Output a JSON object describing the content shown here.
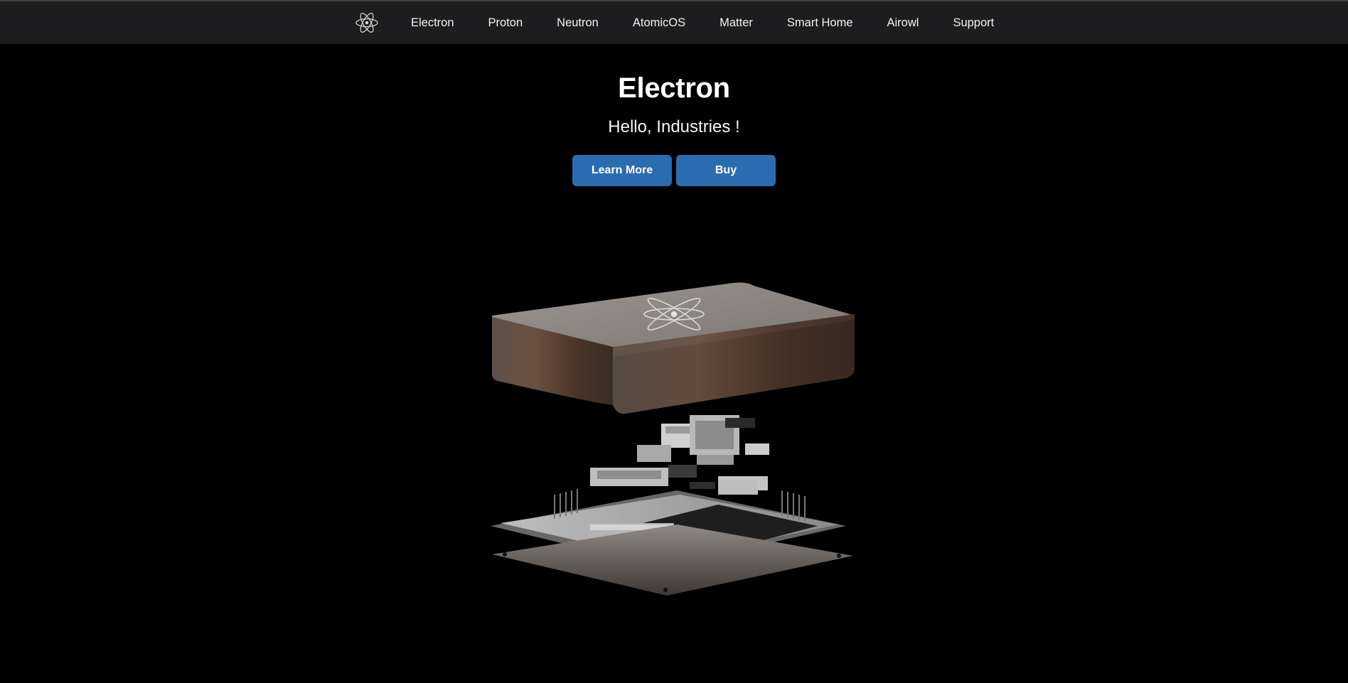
{
  "nav": {
    "logo_icon": "atom-icon",
    "items": [
      {
        "label": "Electron"
      },
      {
        "label": "Proton"
      },
      {
        "label": "Neutron"
      },
      {
        "label": "AtomicOS"
      },
      {
        "label": "Matter"
      },
      {
        "label": "Smart Home"
      },
      {
        "label": "Airowl"
      },
      {
        "label": "Support"
      }
    ]
  },
  "hero": {
    "title": "Electron",
    "subtitle": "Hello, Industries !",
    "learn_more_label": "Learn More",
    "buy_label": "Buy"
  },
  "product": {
    "image_icon": "exploded-device-image"
  },
  "colors": {
    "background": "#000000",
    "navbar": "#1d1d1f",
    "button": "#2b6cb0",
    "case_top": "#8a8582",
    "case_side": "#4a3428"
  }
}
